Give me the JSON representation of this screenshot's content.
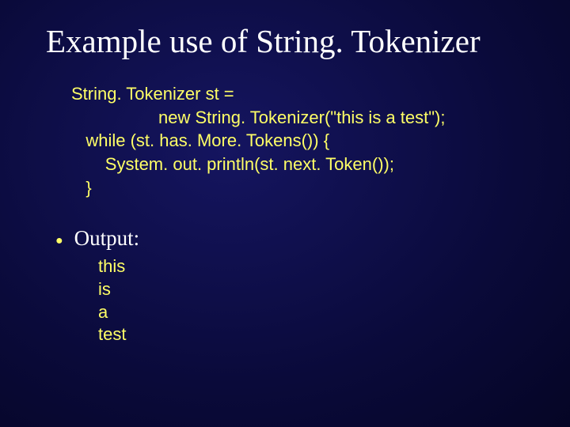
{
  "title": "Example use of String. Tokenizer",
  "code": {
    "line1": "String. Tokenizer st =",
    "line2": "                  new String. Tokenizer(\"this is a test\");",
    "line3": "   while (st. has. More. Tokens()) {",
    "line4": "       System. out. println(st. next. Token());",
    "line5": "   }"
  },
  "output_label": "Output:",
  "output": {
    "o1": "this",
    "o2": "is",
    "o3": "a",
    "o4": "test"
  }
}
